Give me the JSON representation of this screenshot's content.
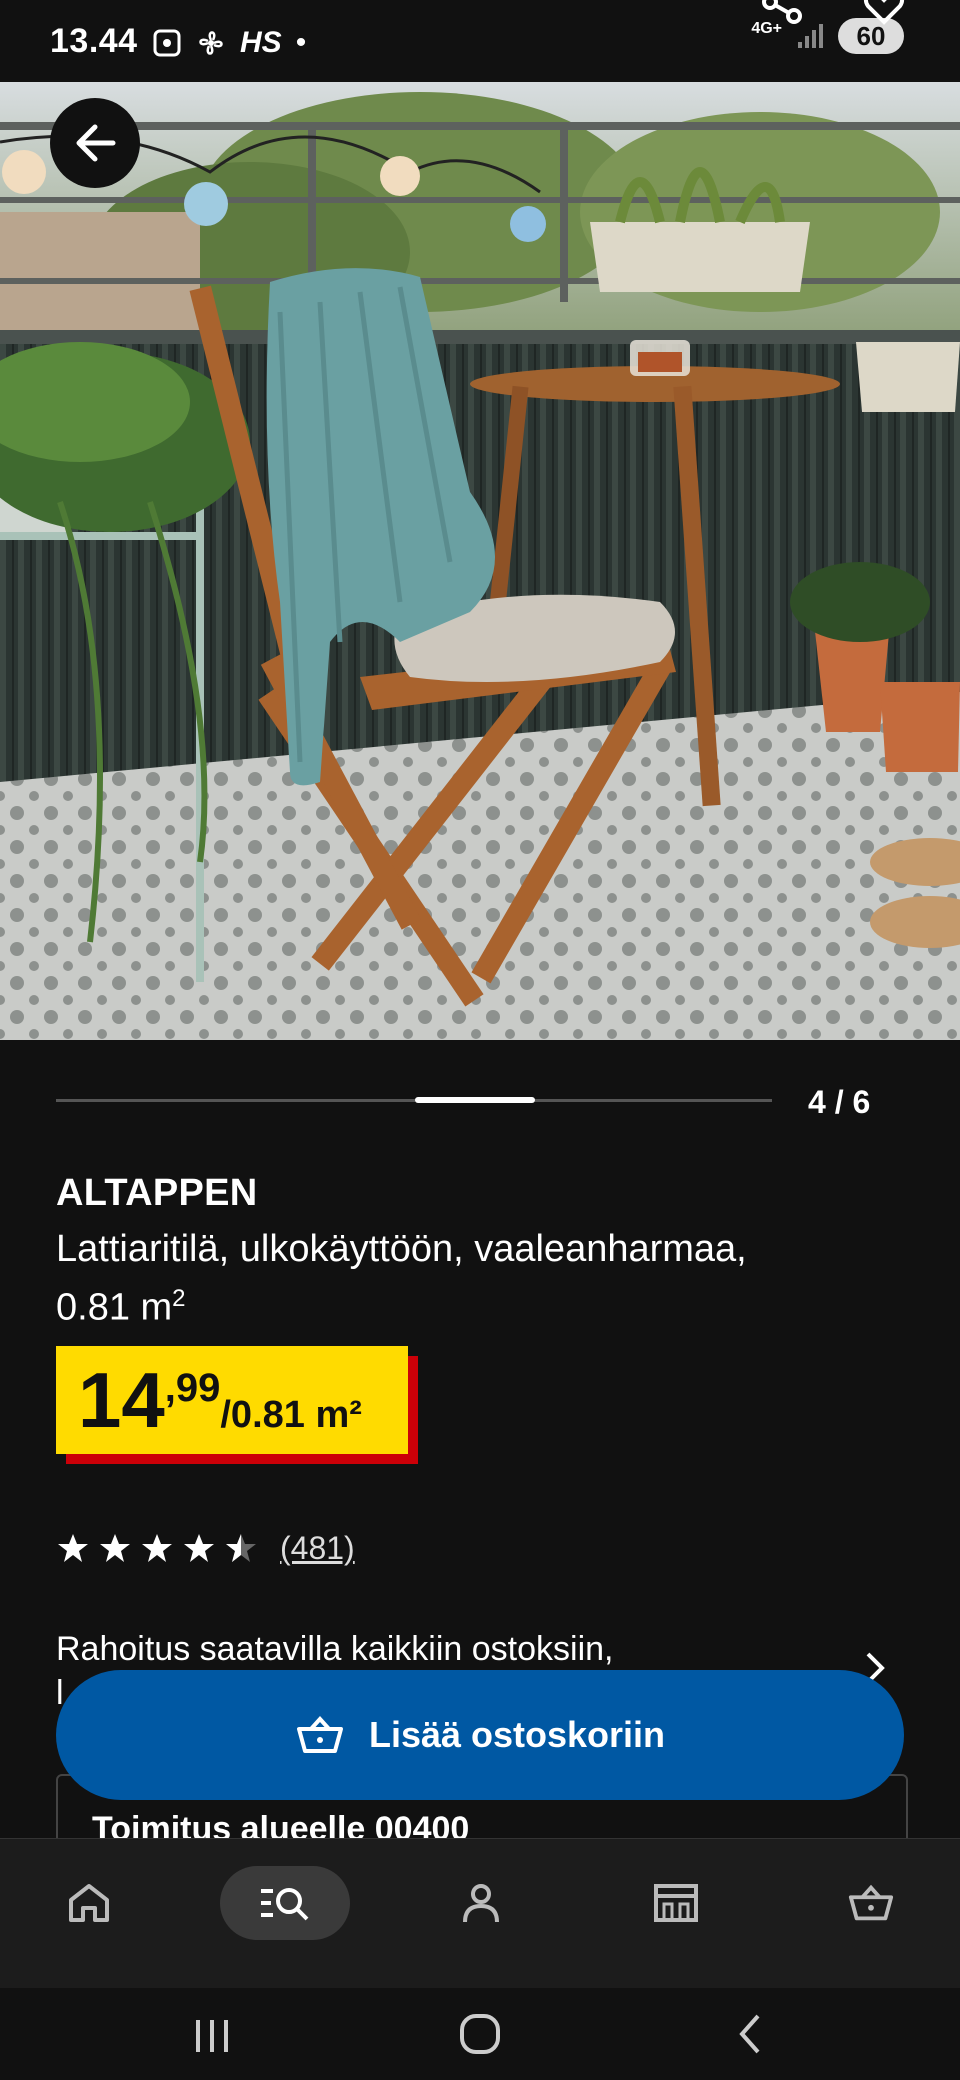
{
  "status_bar": {
    "time": "13.44",
    "carrier": "HS",
    "network": "4G+",
    "battery": "60"
  },
  "gallery": {
    "counter": "4 / 6",
    "current": 4,
    "total": 6
  },
  "product": {
    "name": "ALTAPPEN",
    "description": "Lattiaritilä, ulkokäyttöön, vaaleanharmaa,",
    "size": "0.81 m",
    "size_sup": "2"
  },
  "price": {
    "integer": "14",
    "decimals": ",99",
    "unit": "/0.81 m²"
  },
  "rating": {
    "value": 4.5,
    "max": 5,
    "count": "(481)"
  },
  "finance": {
    "text": "Rahoitus saatavilla kaikkiin ostoksiin,",
    "text2": "l"
  },
  "delivery": {
    "text": "Toimitus alueelle 00400"
  },
  "cart_button": {
    "label": "Lisää ostoskoriin"
  },
  "colors": {
    "accent": "#0058a3",
    "price_bg": "#ffdb00",
    "price_shadow": "#cc0008",
    "background": "#111111"
  },
  "bottom_nav": {
    "items": [
      {
        "name": "home",
        "icon": "home-icon",
        "active": false
      },
      {
        "name": "search",
        "icon": "search-list-icon",
        "active": true
      },
      {
        "name": "profile",
        "icon": "person-icon",
        "active": false
      },
      {
        "name": "store",
        "icon": "store-icon",
        "active": false
      },
      {
        "name": "cart",
        "icon": "basket-icon",
        "active": false
      }
    ]
  }
}
